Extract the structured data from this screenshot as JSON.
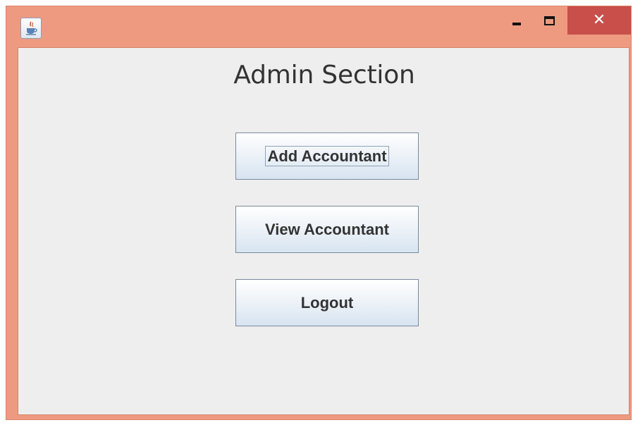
{
  "window": {
    "controls": {
      "minimize_icon": "minimize-icon",
      "maximize_icon": "maximize-icon",
      "close_icon": "close-icon",
      "close_glyph": "✕"
    },
    "colors": {
      "frame": "#ee9a80",
      "close_button": "#c84f4a",
      "client_background": "#eeeeee"
    }
  },
  "main": {
    "title": "Admin Section",
    "buttons": {
      "add_accountant": "Add Accountant",
      "view_accountant": "View Accountant",
      "logout": "Logout"
    }
  }
}
